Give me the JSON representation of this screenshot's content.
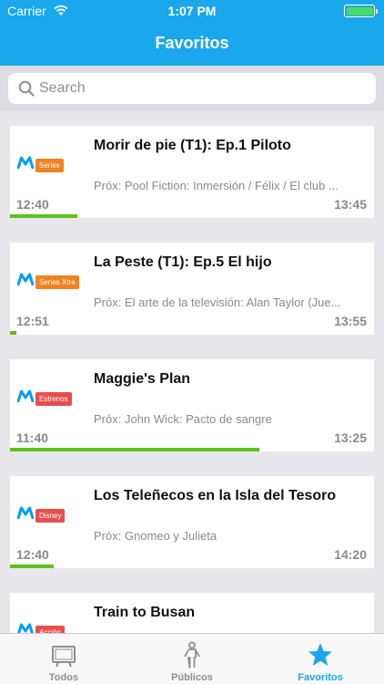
{
  "status_bar": {
    "carrier": "Carrier",
    "time": "1:07 PM"
  },
  "header": {
    "title": "Favoritos"
  },
  "search": {
    "placeholder": "Search"
  },
  "items": [
    {
      "title": "Morir de pie (T1): Ep.1 Piloto",
      "next": "Próx: Pool Fiction: Inmersión / Félix / El club ...",
      "start": "12:40",
      "end": "13:45",
      "progress": 0.18,
      "channel": "Series",
      "channel_color": "#f08224"
    },
    {
      "title": "La Peste (T1): Ep.5 El hijo",
      "next": "Próx: El arte de la televisión: Alan Taylor (Jue...",
      "start": "12:51",
      "end": "13:55",
      "progress": 0.02,
      "channel": "Series Xtra",
      "channel_color": "#f08224"
    },
    {
      "title": "Maggie's Plan",
      "next": "Próx: John Wick: Pacto de sangre",
      "start": "11:40",
      "end": "13:25",
      "progress": 0.69,
      "channel": "Estrenos",
      "channel_color": "#e84e4e"
    },
    {
      "title": "Los Teleñecos en la Isla del Tesoro",
      "next": "Próx: Gnomeo y Julieta",
      "start": "12:40",
      "end": "14:20",
      "progress": 0.12,
      "channel": "Disney",
      "channel_color": "#e84e4e"
    },
    {
      "title": "Train to Busan",
      "next": "",
      "start": "",
      "end": "",
      "progress": 0,
      "channel": "Acción",
      "channel_color": "#e84e4e"
    }
  ],
  "tabbar": {
    "tabs": [
      {
        "label": "Todos",
        "icon": "tv-icon",
        "active": false
      },
      {
        "label": "Públicos",
        "icon": "person-icon",
        "active": false
      },
      {
        "label": "Favoritos",
        "icon": "star-icon",
        "active": true
      }
    ]
  },
  "colors": {
    "accent": "#1aa7ec",
    "progress": "#5cc21a",
    "movistar_blue": "#019df4"
  }
}
